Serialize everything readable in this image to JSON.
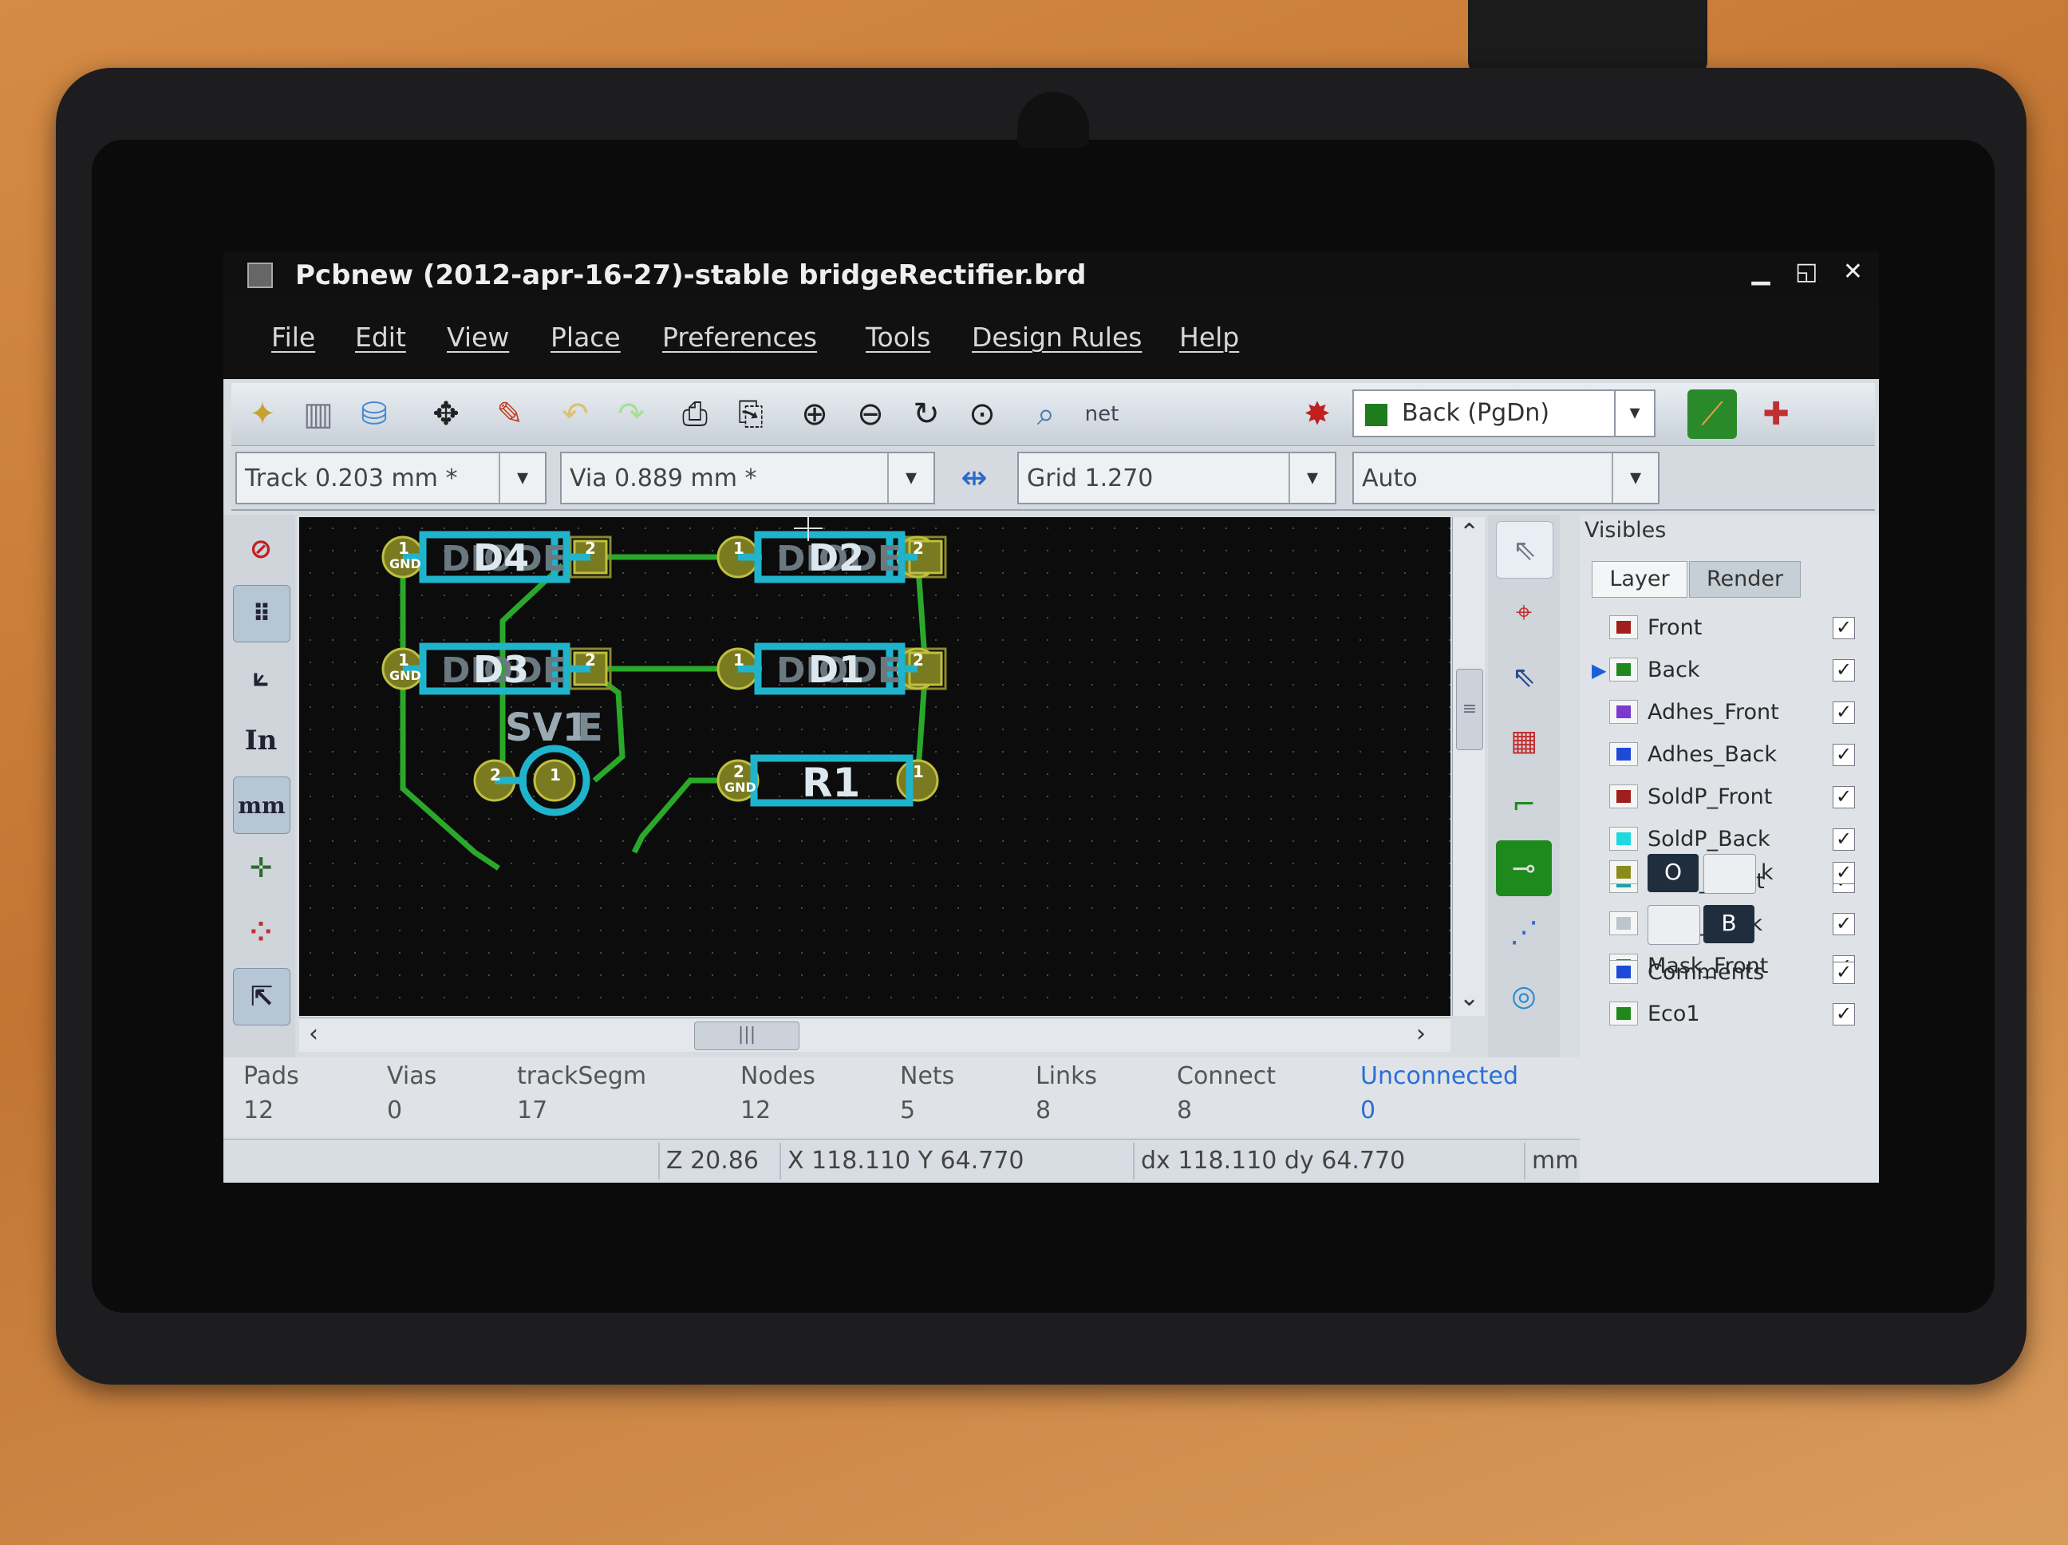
{
  "window": {
    "title": "Pcbnew (2012-apr-16-27)-stable bridgeRectifier.brd",
    "minimize": "▁",
    "restore": "◱",
    "close": "✕"
  },
  "menu": [
    "File",
    "Edit",
    "View",
    "Place",
    "Preferences",
    "Tools",
    "Design Rules",
    "Help"
  ],
  "toolbar": {
    "layer_select": "Back (PgDn)",
    "track": "Track 0.203 mm *",
    "via": "Via 0.889 mm *",
    "grid": "Grid 1.270",
    "zoom": "Auto",
    "netlist_label": "net"
  },
  "left_toolbar": {
    "units_inch": "In",
    "units_mm": "mm"
  },
  "board": {
    "components": [
      {
        "ref": "D4",
        "value": "DIODE",
        "pad1": "1",
        "pad1_net": "GND",
        "pad2": "2"
      },
      {
        "ref": "D2",
        "value": "DIODE",
        "pad1": "1",
        "pad2": "2"
      },
      {
        "ref": "D3",
        "value": "DIODE",
        "pad1": "1",
        "pad1_net": "GND",
        "pad2": "2"
      },
      {
        "ref": "D1",
        "value": "DIODE",
        "pad1": "1",
        "pad2": "2"
      },
      {
        "ref": "SV1",
        "value": "E",
        "pad1": "1",
        "pad2": "2"
      },
      {
        "ref": "R1",
        "pad1": "1",
        "pad2": "2",
        "pad2_net": "GND"
      }
    ]
  },
  "visibles": {
    "title": "Visibles",
    "tabs": [
      "Layer",
      "Render"
    ],
    "active_layer": "Back",
    "layers": [
      {
        "name": "Front",
        "color": "#a01e1e",
        "checked": true
      },
      {
        "name": "Back",
        "color": "#1e8a1e",
        "checked": true
      },
      {
        "name": "Adhes_Front",
        "color": "#7a3ad0",
        "checked": true
      },
      {
        "name": "Adhes_Back",
        "color": "#1e4ad8",
        "checked": true
      },
      {
        "name": "SoldP_Front",
        "color": "#a01e1e",
        "checked": true
      },
      {
        "name": "SoldP_Back",
        "color": "#20d8e0",
        "checked": true
      },
      {
        "name": "SilkS_Front",
        "color": "#1fa0a8",
        "checked": true
      },
      {
        "name": "SilkS_Back",
        "color": "#7a3ad0",
        "checked": true
      },
      {
        "name": "Mask_Front",
        "color": "#7a3ad0",
        "checked": true
      }
    ],
    "toggle_row1": {
      "a": "O",
      "b": "",
      "suffix": "k",
      "color": "#8a8a1e"
    },
    "toggle_row2": {
      "a": "",
      "b": "B",
      "color": "#bcc4cc"
    },
    "extra_layers": [
      {
        "name": "Comments",
        "color": "#1e4ad8",
        "checked": true
      },
      {
        "name": "Eco1",
        "color": "#1e8a1e",
        "checked": true
      }
    ]
  },
  "stats": [
    {
      "label": "Pads",
      "value": "12"
    },
    {
      "label": "Vias",
      "value": "0"
    },
    {
      "label": "trackSegm",
      "value": "17"
    },
    {
      "label": "Nodes",
      "value": "12"
    },
    {
      "label": "Nets",
      "value": "5"
    },
    {
      "label": "Links",
      "value": "8"
    },
    {
      "label": "Connect",
      "value": "8"
    },
    {
      "label": "Unconnected",
      "value": "0"
    }
  ],
  "status": {
    "zoom": "Z 20.86",
    "pos": "X 118.110  Y 64.770",
    "delta": "dx 118.110  dy 64.770",
    "units": "mm"
  }
}
